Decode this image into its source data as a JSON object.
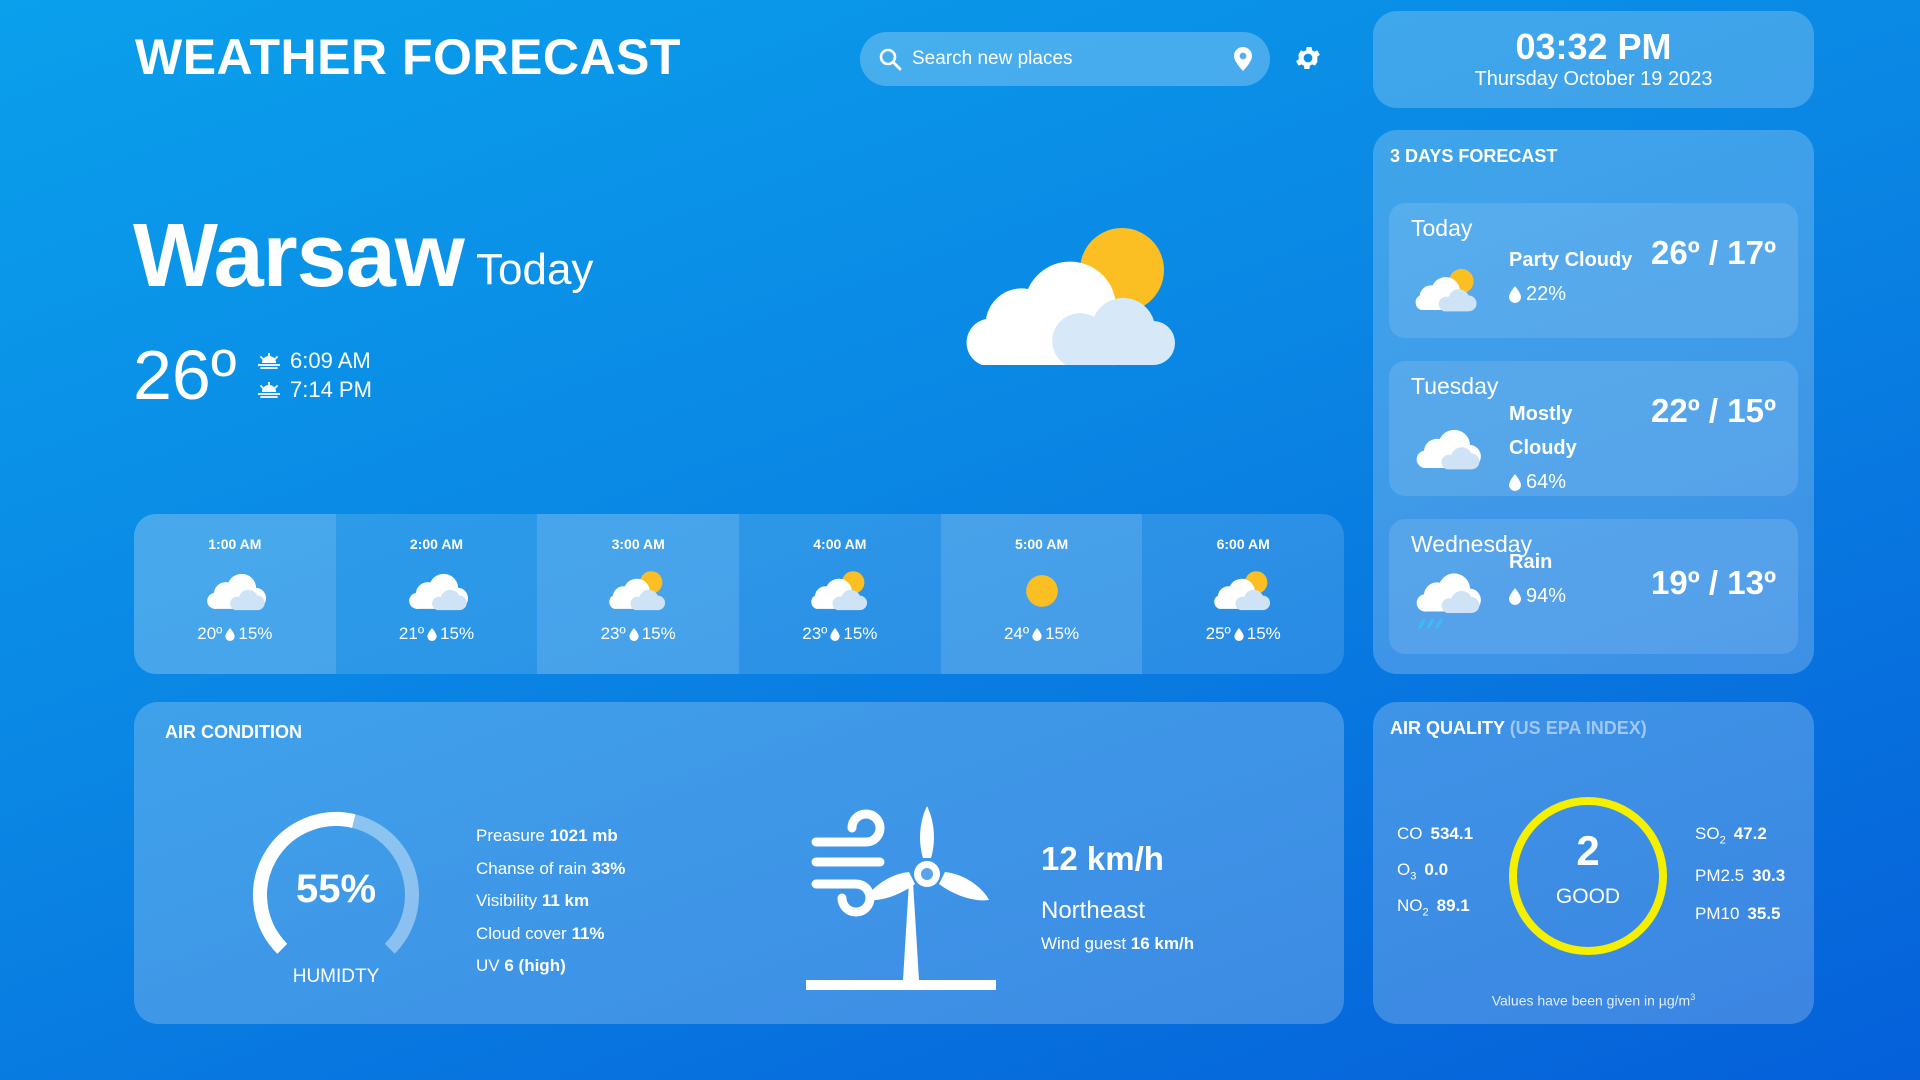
{
  "header": {
    "title": "WEATHER FORECAST",
    "search_placeholder": "Search new places",
    "search_icon": "search-icon",
    "location_icon": "map-pin-icon",
    "settings_icon": "gear-icon"
  },
  "clock": {
    "time": "03:32 PM",
    "date": "Thursday October 19 2023"
  },
  "current": {
    "city": "Warsaw",
    "day_label": "Today",
    "temp": "26º",
    "sunrise": "6:09 AM",
    "sunset": "7:14 PM",
    "icon": "partly-cloudy-icon"
  },
  "hourly": [
    {
      "time": "1:00 AM",
      "icon": "cloud",
      "temp": "20º",
      "rain": "15%"
    },
    {
      "time": "2:00 AM",
      "icon": "cloud",
      "temp": "21º",
      "rain": "15%"
    },
    {
      "time": "3:00 AM",
      "icon": "partly-cloudy",
      "temp": "23º",
      "rain": "15%"
    },
    {
      "time": "4:00 AM",
      "icon": "partly-cloudy",
      "temp": "23º",
      "rain": "15%"
    },
    {
      "time": "5:00 AM",
      "icon": "sun",
      "temp": "24º",
      "rain": "15%"
    },
    {
      "time": "6:00 AM",
      "icon": "partly-cloudy",
      "temp": "25º",
      "rain": "15%"
    }
  ],
  "forecast": {
    "title": "3 DAYS FORECAST",
    "days": [
      {
        "day": "Today",
        "condition": "Party Cloudy",
        "rain": "22%",
        "temp": "26º / 17º",
        "icon": "partly-cloudy"
      },
      {
        "day": "Tuesday",
        "condition": "Mostly Cloudy",
        "rain": "64%",
        "temp": "22º / 15º",
        "icon": "cloud"
      },
      {
        "day": "Wednesday",
        "condition": "Rain",
        "rain": "94%",
        "temp": "19º / 13º",
        "icon": "rain"
      }
    ]
  },
  "air_condition": {
    "title": "AIR CONDITION",
    "humidity_value": "55%",
    "humidity_fraction": 0.55,
    "humidity_label": "HUMIDTY",
    "details": [
      {
        "label": "Preasure",
        "value": "1021 mb"
      },
      {
        "label": "Chanse of rain",
        "value": "33%"
      },
      {
        "label": "Visibility",
        "value": "11 km"
      },
      {
        "label": "Cloud cover",
        "value": "11%"
      },
      {
        "label": "UV",
        "value": "6 (high)"
      }
    ],
    "wind_speed": "12 km/h",
    "wind_direction": "Northeast",
    "wind_gust_label": "Wind guest",
    "wind_gust_value": "16 km/h"
  },
  "air_quality": {
    "title": "AIR QUALITY",
    "title_suffix": "(US EPA INDEX)",
    "index": "2",
    "status": "GOOD",
    "ring_color": "#f5f000",
    "left": [
      {
        "label": "CO",
        "value": "534.1"
      },
      {
        "label": "O",
        "sub": "3",
        "value": "0.0"
      },
      {
        "label": "NO",
        "sub": "2",
        "value": "89.1"
      }
    ],
    "right": [
      {
        "label": "SO",
        "sub": "2",
        "value": "47.2"
      },
      {
        "label": "PM2.5",
        "value": "30.3"
      },
      {
        "label": "PM10",
        "value": "35.5"
      }
    ],
    "footnote": "Values have been given in µg/m",
    "footnote_sup": "3"
  }
}
